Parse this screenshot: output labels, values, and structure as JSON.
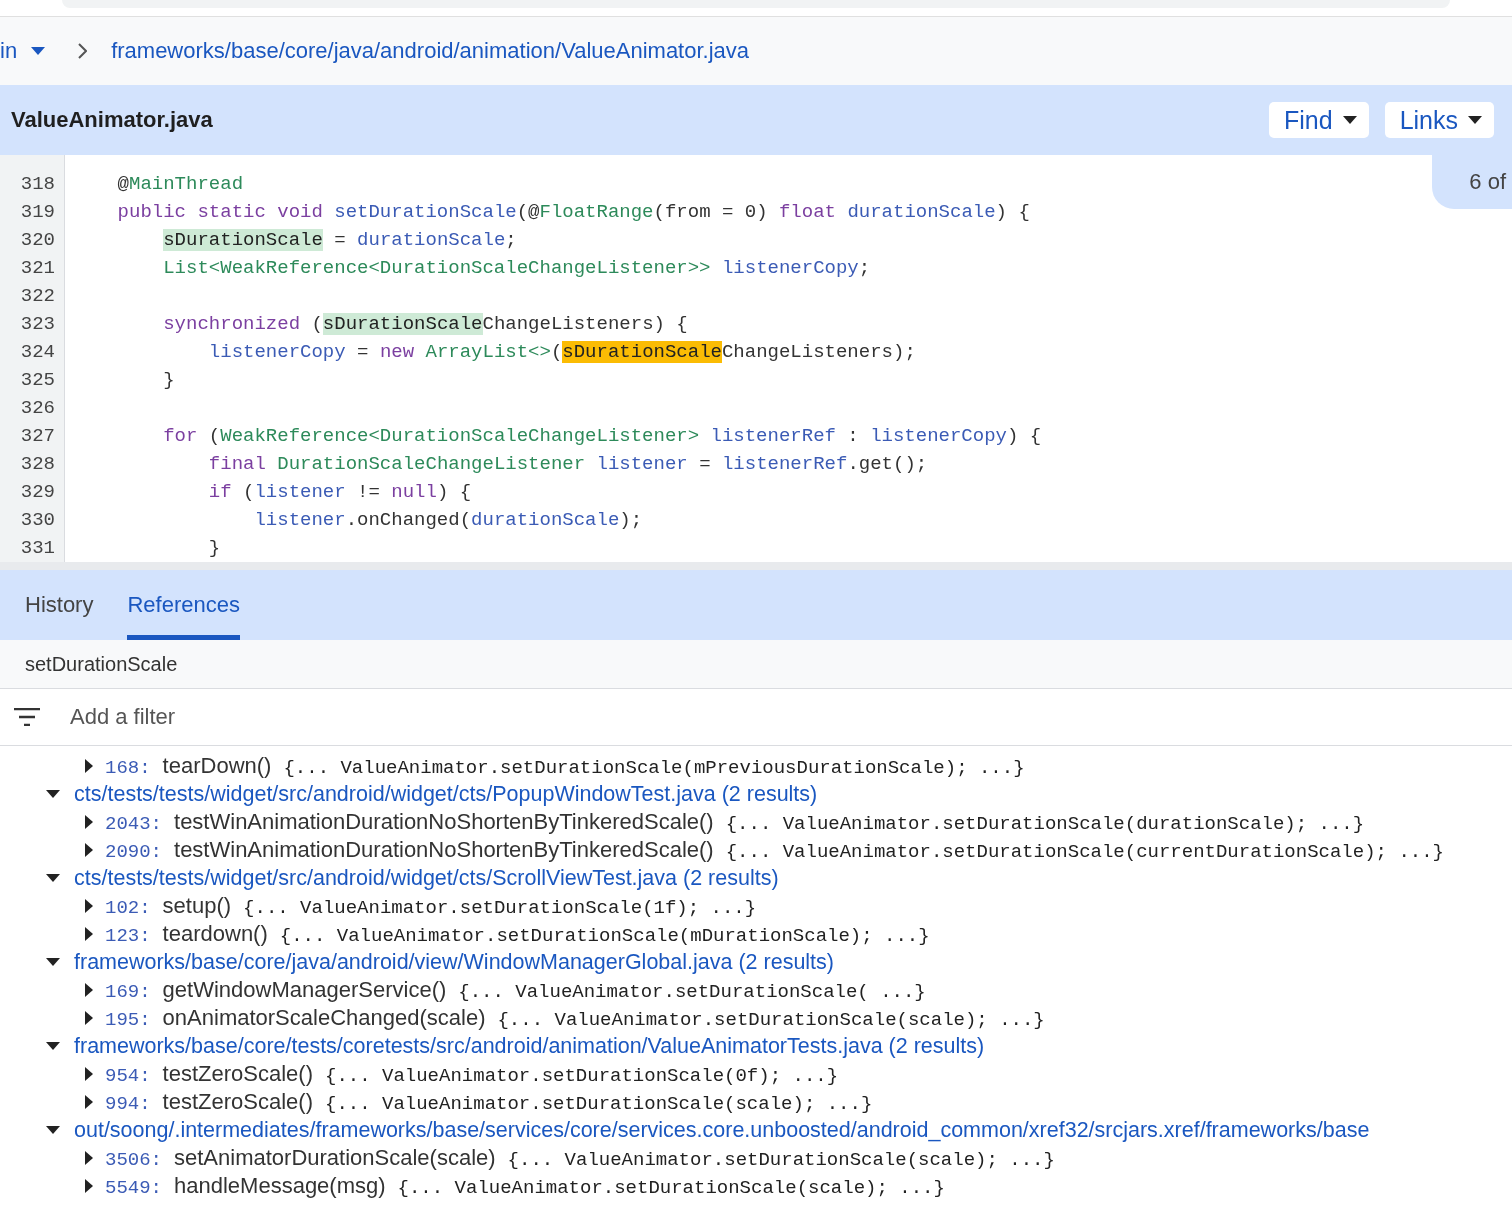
{
  "breadcrumb": {
    "branch": "in",
    "path": "frameworks/base/core/java/android/animation/ValueAnimator.java"
  },
  "file_header": {
    "title": "ValueAnimator.java",
    "buttons": [
      "Find",
      "Links"
    ]
  },
  "match_counter": "6 of",
  "code": [
    {
      "number": "318",
      "tokens": [
        {
          "text": "    @",
          "kind": "plain"
        },
        {
          "text": "MainThread",
          "kind": "type"
        }
      ]
    },
    {
      "number": "319",
      "tokens": [
        {
          "text": "    public static void ",
          "kind": "keyword"
        },
        {
          "text": "setDurationScale",
          "kind": "name"
        },
        {
          "text": "(@",
          "kind": "plain"
        },
        {
          "text": "FloatRange",
          "kind": "type"
        },
        {
          "text": "(from = 0) ",
          "kind": "plain"
        },
        {
          "text": "float ",
          "kind": "keyword"
        },
        {
          "text": "durationScale",
          "kind": "name"
        },
        {
          "text": ") {",
          "kind": "plain"
        }
      ]
    },
    {
      "number": "320",
      "tokens": [
        {
          "text": "        sDurationScale",
          "kind": "highlight"
        },
        {
          "text": " = ",
          "kind": "plain"
        },
        {
          "text": "durationScale",
          "kind": "name"
        },
        {
          "text": ";",
          "kind": "plain"
        }
      ]
    },
    {
      "number": "321",
      "tokens": [
        {
          "text": "        List<WeakReference<DurationScaleChangeListener>> ",
          "kind": "type"
        },
        {
          "text": "listenerCopy",
          "kind": "name"
        },
        {
          "text": ";",
          "kind": "plain"
        }
      ]
    },
    {
      "number": "322"
    },
    {
      "number": "323",
      "tokens": [
        {
          "text": "        synchronized ",
          "kind": "keyword"
        },
        {
          "text": "(",
          "kind": "plain"
        },
        {
          "text": "sDurationScale",
          "kind": "highlight"
        },
        {
          "text": "ChangeListeners) {",
          "kind": "plain"
        }
      ]
    },
    {
      "number": "324",
      "tokens": [
        {
          "text": "            listenerCopy",
          "kind": "name"
        },
        {
          "text": " = ",
          "kind": "plain"
        },
        {
          "text": "new ",
          "kind": "keyword"
        },
        {
          "text": "ArrayList<>",
          "kind": "type"
        },
        {
          "text": "(",
          "kind": "plain"
        },
        {
          "text": "sDurationScale",
          "kind": "match"
        },
        {
          "text": "ChangeListeners);",
          "kind": "plain"
        }
      ]
    },
    {
      "number": "325",
      "tokens": [
        {
          "text": "        }",
          "kind": "plain"
        }
      ]
    },
    {
      "number": "326"
    },
    {
      "number": "327",
      "tokens": [
        {
          "text": "        for ",
          "kind": "keyword"
        },
        {
          "text": "(",
          "kind": "plain"
        },
        {
          "text": "WeakReference<DurationScaleChangeListener> ",
          "kind": "type"
        },
        {
          "text": "listenerRef",
          "kind": "name"
        },
        {
          "text": " : ",
          "kind": "plain"
        },
        {
          "text": "listenerCopy",
          "kind": "name"
        },
        {
          "text": ") {",
          "kind": "plain"
        }
      ]
    },
    {
      "number": "328",
      "tokens": [
        {
          "text": "            final ",
          "kind": "keyword"
        },
        {
          "text": "DurationScaleChangeListener ",
          "kind": "type"
        },
        {
          "text": "listener",
          "kind": "name"
        },
        {
          "text": " = ",
          "kind": "plain"
        },
        {
          "text": "listenerRef",
          "kind": "name"
        },
        {
          "text": ".get();",
          "kind": "plain"
        }
      ]
    },
    {
      "number": "329",
      "tokens": [
        {
          "text": "            if ",
          "kind": "keyword"
        },
        {
          "text": "(",
          "kind": "plain"
        },
        {
          "text": "listener",
          "kind": "name"
        },
        {
          "text": " != ",
          "kind": "plain"
        },
        {
          "text": "null",
          "kind": "keyword"
        },
        {
          "text": ") {",
          "kind": "plain"
        }
      ]
    },
    {
      "number": "330",
      "tokens": [
        {
          "text": "                listener",
          "kind": "name"
        },
        {
          "text": ".onChanged(",
          "kind": "plain"
        },
        {
          "text": "durationScale",
          "kind": "name"
        },
        {
          "text": ");",
          "kind": "plain"
        }
      ]
    },
    {
      "number": "331",
      "tokens": [
        {
          "text": "            }",
          "kind": "plain"
        }
      ]
    }
  ],
  "tabs": [
    {
      "label": "History",
      "selected": false
    },
    {
      "label": "References",
      "selected": true
    }
  ],
  "references_title": "setDurationScale",
  "filter": {
    "placeholder": "Add a filter"
  },
  "results": [
    {
      "kind": "match",
      "expanded": false,
      "line": "168:",
      "function": "tearDown()",
      "snippet": "{... ValueAnimator.setDurationScale(mPreviousDurationScale); ...}"
    },
    {
      "kind": "file",
      "expanded": true,
      "path": "cts/tests/tests/widget/src/android/widget/cts/PopupWindowTest.java (2 results)",
      "children": [
        {
          "kind": "match",
          "expanded": false,
          "line": "2043:",
          "function": "testWinAnimationDurationNoShortenByTinkeredScale()",
          "snippet": "{... ValueAnimator.setDurationScale(durationScale); ...}"
        },
        {
          "kind": "match",
          "expanded": false,
          "line": "2090:",
          "function": "testWinAnimationDurationNoShortenByTinkeredScale()",
          "snippet": "{... ValueAnimator.setDurationScale(currentDurationScale); ...}"
        }
      ]
    },
    {
      "kind": "file",
      "expanded": true,
      "path": "cts/tests/tests/widget/src/android/widget/cts/ScrollViewTest.java (2 results)",
      "children": [
        {
          "kind": "match",
          "expanded": false,
          "line": "102:",
          "function": "setup()",
          "snippet": "{... ValueAnimator.setDurationScale(1f); ...}"
        },
        {
          "kind": "match",
          "expanded": false,
          "line": "123:",
          "function": "teardown()",
          "snippet": "{... ValueAnimator.setDurationScale(mDurationScale); ...}"
        }
      ]
    },
    {
      "kind": "file",
      "expanded": true,
      "path": "frameworks/base/core/java/android/view/WindowManagerGlobal.java (2 results)",
      "children": [
        {
          "kind": "match",
          "expanded": false,
          "line": "169:",
          "function": "getWindowManagerService()",
          "snippet": "{... ValueAnimator.setDurationScale( ...}"
        },
        {
          "kind": "match",
          "expanded": false,
          "line": "195:",
          "function": "onAnimatorScaleChanged(scale)",
          "snippet": "{... ValueAnimator.setDurationScale(scale); ...}"
        }
      ]
    },
    {
      "kind": "file",
      "expanded": true,
      "path": "frameworks/base/core/tests/coretests/src/android/animation/ValueAnimatorTests.java (2 results)",
      "children": [
        {
          "kind": "match",
          "expanded": false,
          "line": "954:",
          "function": "testZeroScale()",
          "snippet": "{... ValueAnimator.setDurationScale(0f); ...}"
        },
        {
          "kind": "match",
          "expanded": false,
          "line": "994:",
          "function": "testZeroScale()",
          "snippet": "{... ValueAnimator.setDurationScale(scale); ...}"
        }
      ]
    },
    {
      "kind": "file",
      "expanded": true,
      "path": "out/soong/.intermediates/frameworks/base/services/core/services.core.unboosted/android_common/xref32/srcjars.xref/frameworks/base",
      "children": [
        {
          "kind": "match",
          "expanded": false,
          "line": "3506:",
          "function": "setAnimatorDurationScale(scale)",
          "snippet": "{... ValueAnimator.setDurationScale(scale); ...}"
        },
        {
          "kind": "match",
          "expanded": false,
          "line": "5549:",
          "function": "handleMessage(msg)",
          "snippet": "{... ValueAnimator.setDurationScale(scale); ...}"
        }
      ]
    }
  ]
}
